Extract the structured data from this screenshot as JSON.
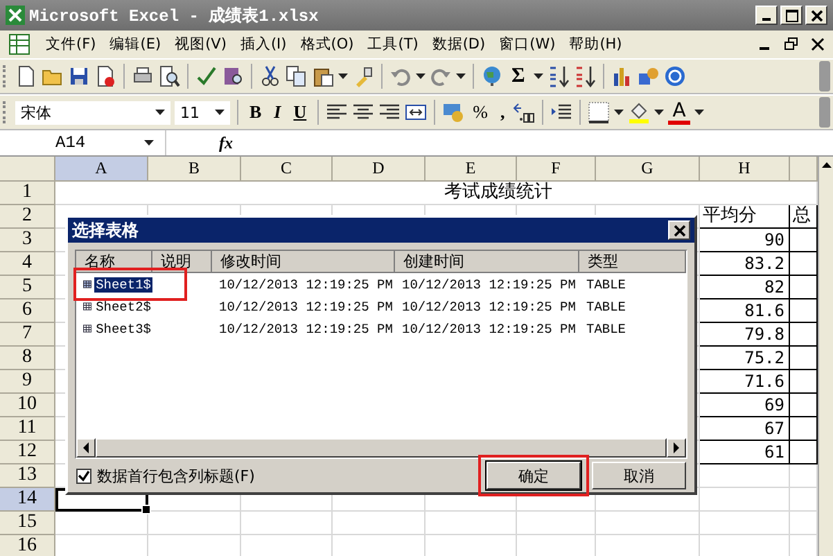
{
  "window": {
    "title": "Microsoft Excel - 成绩表1.xlsx"
  },
  "menu": [
    "文件(F)",
    "编辑(E)",
    "视图(V)",
    "插入(I)",
    "格式(O)",
    "工具(T)",
    "数据(D)",
    "窗口(W)",
    "帮助(H)"
  ],
  "standard_toolbar": {
    "autosum": "Σ"
  },
  "format_toolbar": {
    "font": "宋体",
    "size": "11",
    "bold": "B",
    "italic": "I",
    "underline": "U",
    "percent": "%",
    "comma": ",",
    "font_color": "A"
  },
  "formula_bar": {
    "name_box": "A14",
    "fx": "fx"
  },
  "sheet": {
    "columns": [
      {
        "label": "A",
        "selected": true
      },
      {
        "label": "B",
        "selected": false
      },
      {
        "label": "C",
        "selected": false
      },
      {
        "label": "D",
        "selected": false
      },
      {
        "label": "E",
        "selected": false
      },
      {
        "label": "F",
        "selected": false
      },
      {
        "label": "G",
        "selected": false
      },
      {
        "label": "H",
        "selected": false
      }
    ],
    "rows": [
      {
        "label": "1",
        "selected": false
      },
      {
        "label": "2",
        "selected": false
      },
      {
        "label": "3",
        "selected": false
      },
      {
        "label": "4",
        "selected": false
      },
      {
        "label": "5",
        "selected": false
      },
      {
        "label": "6",
        "selected": false
      },
      {
        "label": "7",
        "selected": false
      },
      {
        "label": "8",
        "selected": false
      },
      {
        "label": "9",
        "selected": false
      },
      {
        "label": "10",
        "selected": false
      },
      {
        "label": "11",
        "selected": false
      },
      {
        "label": "12",
        "selected": false
      },
      {
        "label": "13",
        "selected": false
      },
      {
        "label": "14",
        "selected": true
      },
      {
        "label": "15",
        "selected": false
      },
      {
        "label": "16",
        "selected": false
      }
    ],
    "title": "考试成绩统计",
    "average_header": "平均分",
    "averages": [
      "90",
      "83.2",
      "82",
      "81.6",
      "79.8",
      "75.2",
      "71.6",
      "69",
      "67",
      "61"
    ],
    "column_9_header": "总"
  },
  "dialog": {
    "title": "选择表格",
    "columns": [
      "名称",
      "说明",
      "修改时间",
      "创建时间",
      "类型"
    ],
    "rows": [
      {
        "name": "Sheet1$",
        "modified": "10/12/2013 12:19:25 PM",
        "created": "10/12/2013 12:19:25 PM",
        "type": "TABLE",
        "selected": true,
        "annotated": true
      },
      {
        "name": "Sheet2$",
        "modified": "10/12/2013 12:19:25 PM",
        "created": "10/12/2013 12:19:25 PM",
        "type": "TABLE",
        "selected": false,
        "annotated": false
      },
      {
        "name": "Sheet3$",
        "modified": "10/12/2013 12:19:25 PM",
        "created": "10/12/2013 12:19:25 PM",
        "type": "TABLE",
        "selected": false,
        "annotated": false
      }
    ],
    "header_checkbox": {
      "label": "数据首行包含列标题(F)",
      "checked": true
    },
    "buttons": [
      {
        "label": "确定",
        "annotated": true
      },
      {
        "label": "取消",
        "annotated": false
      }
    ]
  }
}
